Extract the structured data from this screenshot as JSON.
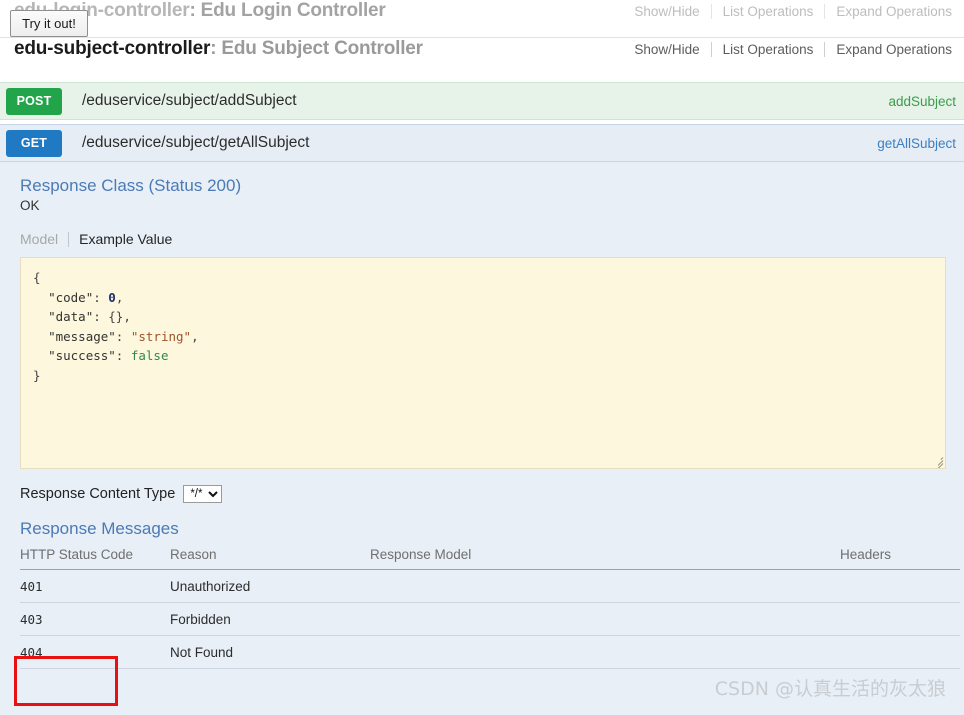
{
  "resources": [
    {
      "name": "edu-login-controller",
      "separator": ":",
      "description": "Edu Login Controller",
      "options": {
        "show_hide": "Show/Hide",
        "list_operations": "List Operations",
        "expand_operations": "Expand Operations"
      }
    },
    {
      "name": "edu-subject-controller",
      "separator": ":",
      "description": "Edu Subject Controller",
      "options": {
        "show_hide": "Show/Hide",
        "list_operations": "List Operations",
        "expand_operations": "Expand Operations"
      }
    }
  ],
  "operations": [
    {
      "method": "POST",
      "path": "/eduservice/subject/addSubject",
      "nickname": "addSubject",
      "color": "#22a44a"
    },
    {
      "method": "GET",
      "path": "/eduservice/subject/getAllSubject",
      "nickname": "getAllSubject",
      "color": "#2079c3"
    }
  ],
  "expanded": {
    "response_class_title": "Response Class (Status 200)",
    "response_class_status": "OK",
    "tabs": {
      "model": "Model",
      "example_value": "Example Value"
    },
    "example_value": {
      "open_brace": "{",
      "close_brace": "}",
      "fields": [
        {
          "key": "\"code\"",
          "value": "0",
          "type": "num",
          "comma": ","
        },
        {
          "key": "\"data\"",
          "value": "{}",
          "type": "punc",
          "comma": ","
        },
        {
          "key": "\"message\"",
          "value": "\"string\"",
          "type": "str",
          "comma": ","
        },
        {
          "key": "\"success\"",
          "value": "false",
          "type": "bool",
          "comma": ""
        }
      ]
    },
    "content_type_label": "Response Content Type",
    "content_type_selected": "*/*",
    "content_type_options": [
      "*/*"
    ],
    "response_messages_title": "Response Messages",
    "table": {
      "headers": [
        "HTTP Status Code",
        "Reason",
        "Response Model",
        "Headers"
      ],
      "rows": [
        {
          "code": "401",
          "reason": "Unauthorized",
          "model": "",
          "headers": ""
        },
        {
          "code": "403",
          "reason": "Forbidden",
          "model": "",
          "headers": ""
        },
        {
          "code": "404",
          "reason": "Not Found",
          "model": "",
          "headers": ""
        }
      ]
    },
    "try_it_out_label": "Try it out!"
  },
  "watermark": "CSDN @认真生活的灰太狼",
  "colors": {
    "post_green": "#22a44a",
    "get_blue": "#2079c3",
    "link_blue": "#4b7ab5",
    "annotation_red": "#e81010",
    "code_bg": "#fcf7dd",
    "body_bg": "#e8eff7"
  }
}
